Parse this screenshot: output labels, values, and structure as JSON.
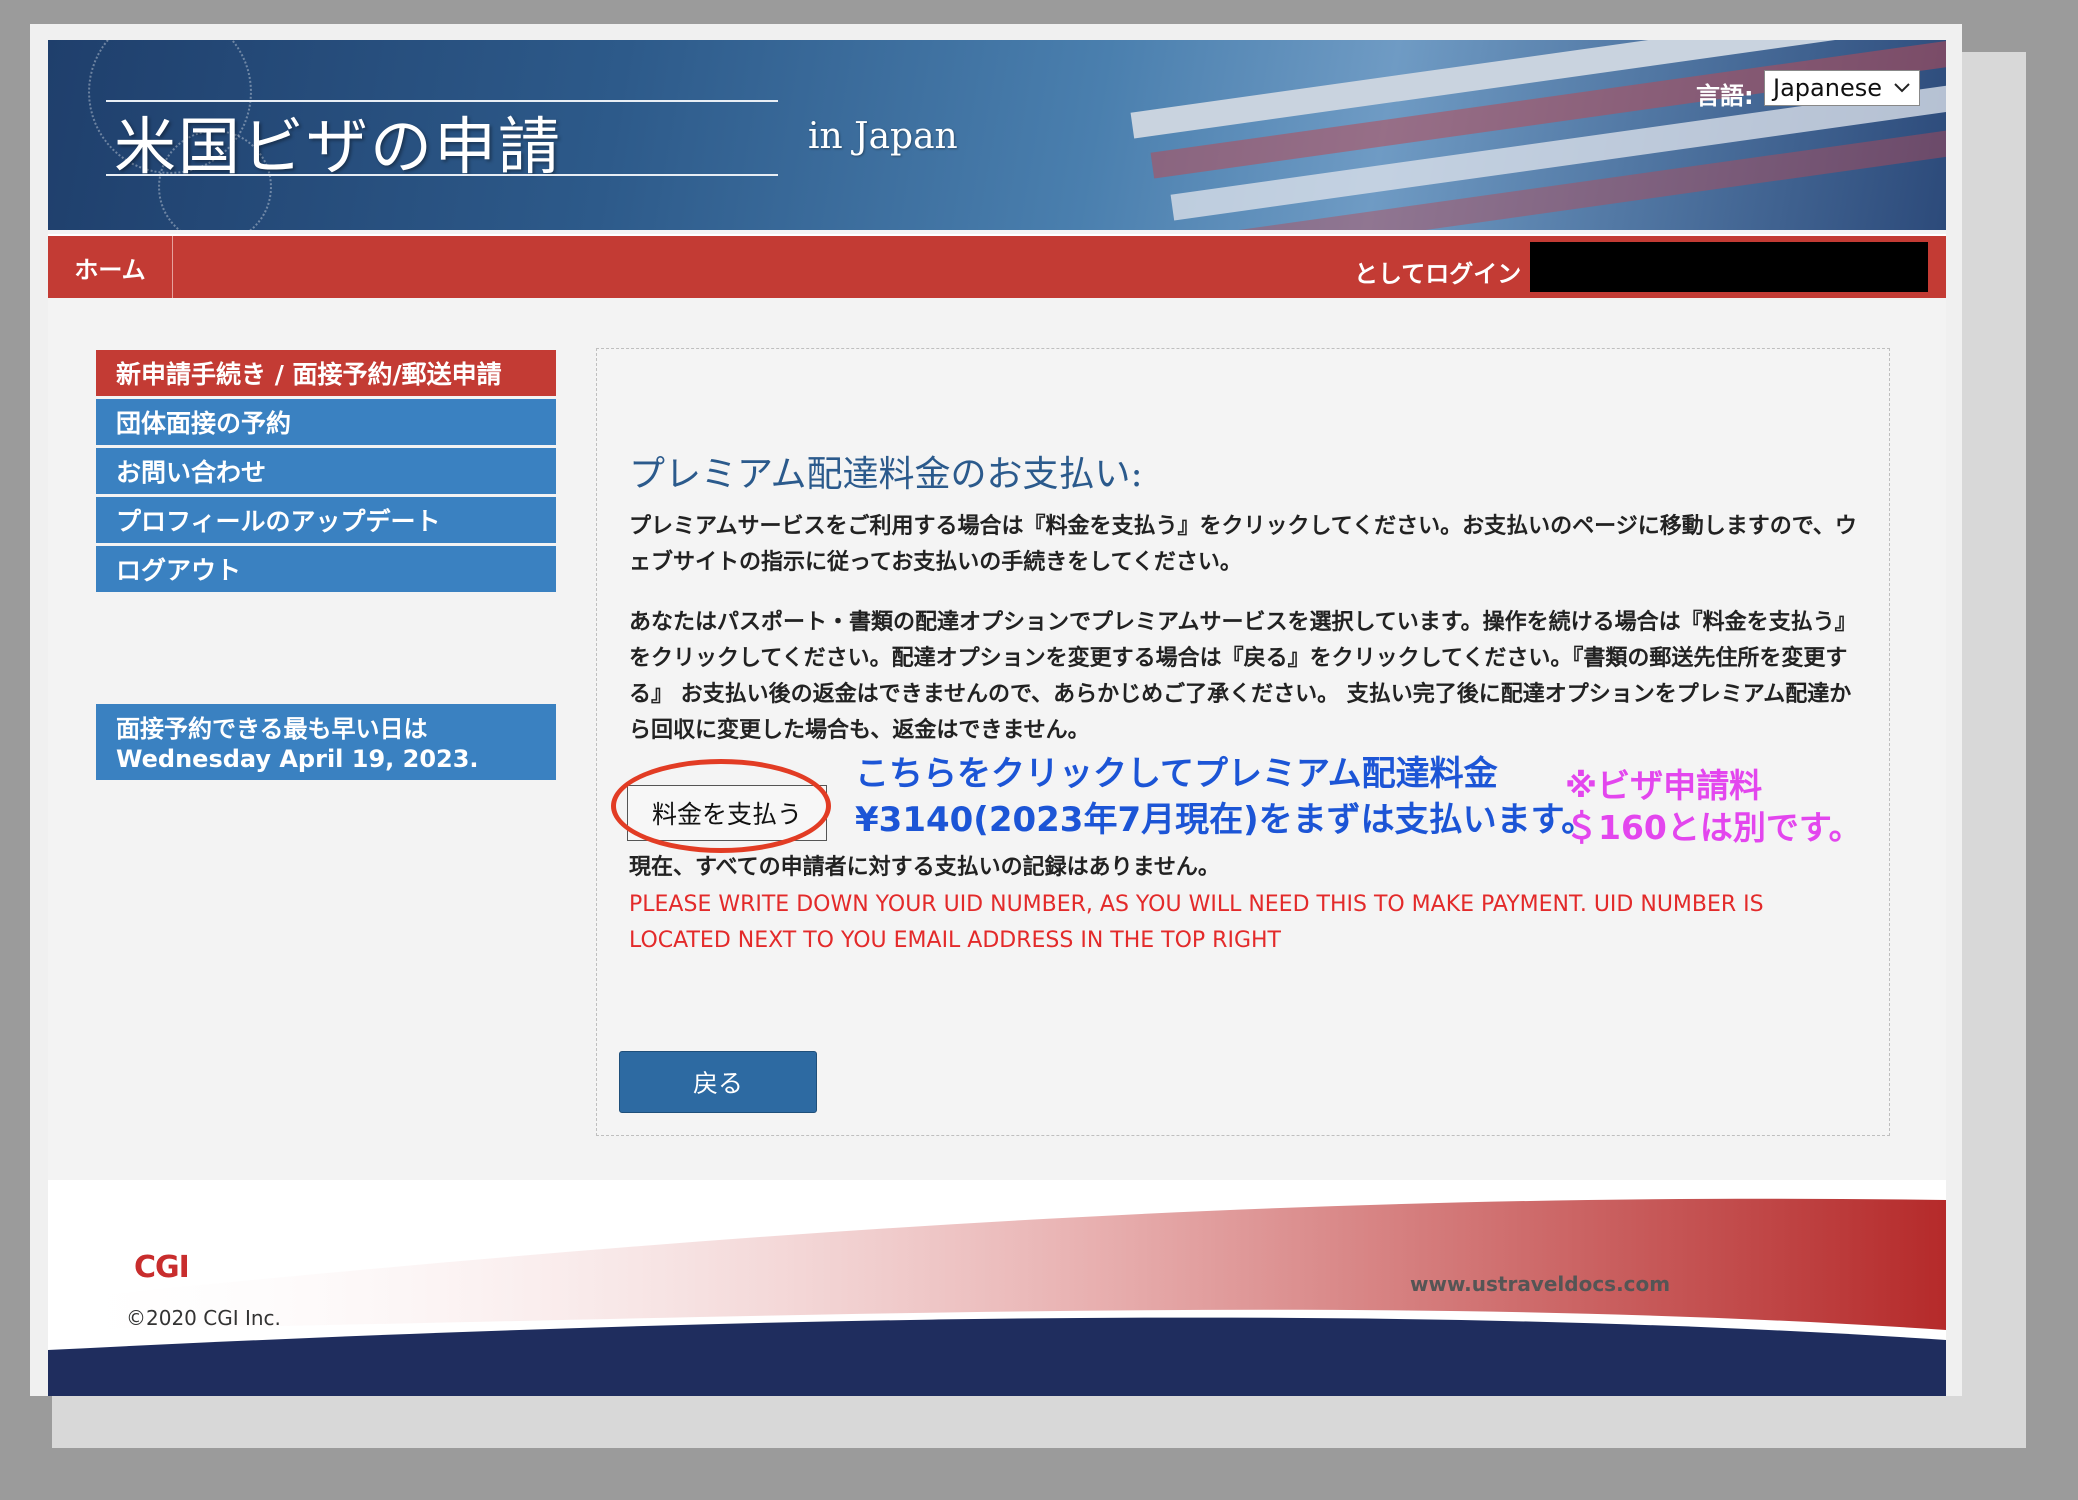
{
  "header": {
    "title": "米国ビザの申請",
    "subtitle": "in Japan",
    "language_label": "言語:",
    "language_value": "Japanese"
  },
  "navbar": {
    "home_label": "ホーム",
    "login_as_label": "としてログイン"
  },
  "sidebar": {
    "items": [
      {
        "label": "新申請手続き / 面接予約/郵送申請"
      },
      {
        "label": "団体面接の予約"
      },
      {
        "label": "お問い合わせ"
      },
      {
        "label": "プロフィールのアップデート"
      },
      {
        "label": "ログアウト"
      }
    ],
    "earliest_line1": "面接予約できる最も早い日は",
    "earliest_line2": "Wednesday April 19, 2023."
  },
  "main": {
    "title": "プレミアム配達料金のお支払い:",
    "para1": "プレミアムサービスをご利用する場合は『料金を支払う』をクリックしてください。お支払いのページに移動しますので、ウェブサイトの指示に従ってお支払いの手続きをしてください。",
    "para2": "あなたはパスポート・書類の配達オプションでプレミアムサービスを選択しています。操作を続ける場合は『料金を支払う』をクリックしてください。配達オプションを変更する場合は『戻る』をクリックしてください。『書類の郵送先住所を変更する』 お支払い後の返金はできませんので、あらかじめご了承ください。 支払い完了後に配達オプションをプレミアム配達から回収に変更した場合も、返金はできません。",
    "pay_button": "料金を支払う",
    "annotation_blue_line1": "こちらをクリックしてプレミアム配達料金",
    "annotation_blue_line2": "¥3140(2023年7月現在)をまずは支払います。",
    "annotation_pink_line1": "※ビザ申請料",
    "annotation_pink_line2": "＄160とは別です。",
    "no_record": "現在、すべての申請者に対する支払いの記録はありません。",
    "warning": "PLEASE WRITE DOWN YOUR UID NUMBER, AS YOU WILL NEED THIS TO MAKE PAYMENT. UID NUMBER IS LOCATED NEXT TO YOU EMAIL ADDRESS IN THE TOP RIGHT",
    "back_button": "戻る"
  },
  "footer": {
    "logo": "CGI",
    "copyright": "©2020 CGI Inc.",
    "url": "www.ustraveldocs.com"
  },
  "colors": {
    "nav_red": "#c33b34",
    "side_blue": "#3a81c1",
    "annotation_blue": "#1c55d6",
    "annotation_pink": "#e346ee",
    "annotation_circle": "#e23c24",
    "warning_red": "#e32a2a"
  },
  "icons": {
    "dropdown": "chevron-down-icon"
  }
}
